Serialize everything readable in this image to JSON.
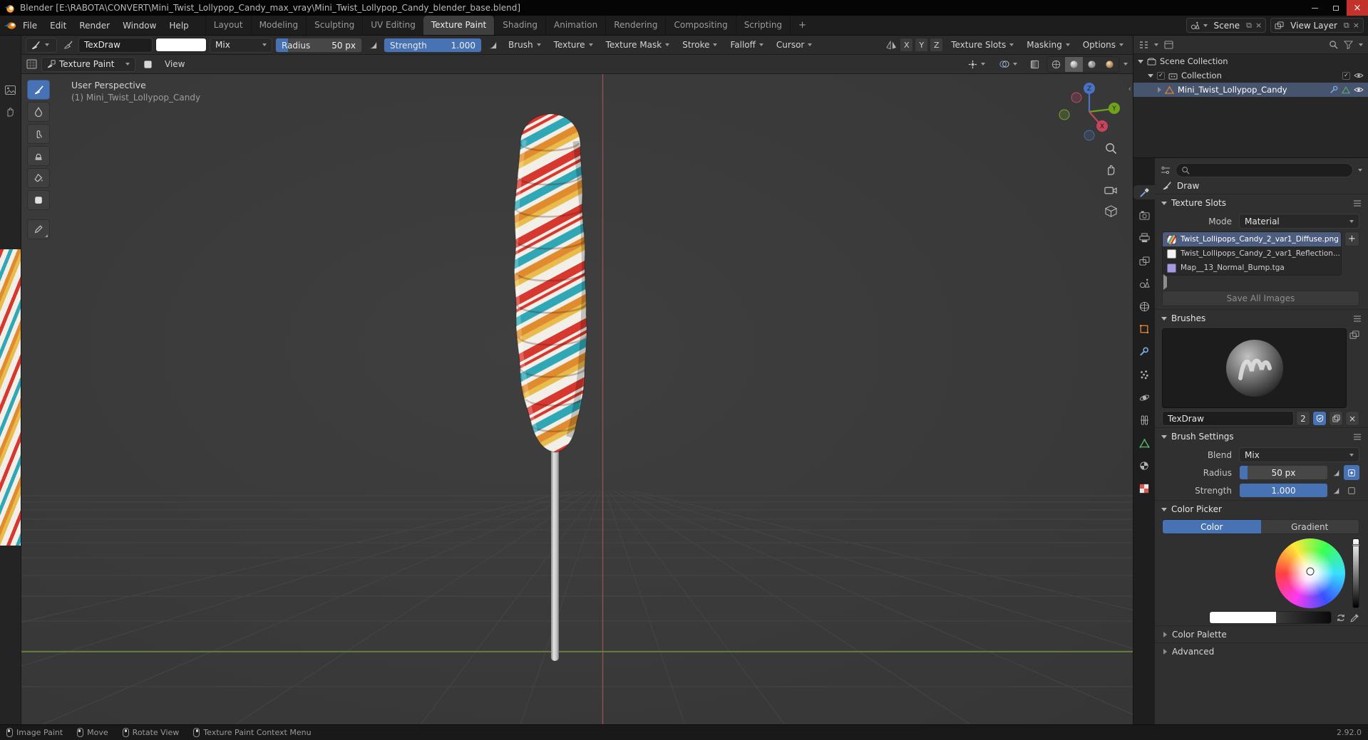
{
  "window": {
    "title": "Blender [E:\\RABOTA\\CONVERT\\Mini_Twist_Lollypop_Candy_max_vray\\Mini_Twist_Lollypop_Candy_blender_base.blend]"
  },
  "topbar": {
    "menus": [
      "File",
      "Edit",
      "Render",
      "Window",
      "Help"
    ],
    "workspaces": [
      "Layout",
      "Modeling",
      "Sculpting",
      "UV Editing",
      "Texture Paint",
      "Shading",
      "Animation",
      "Rendering",
      "Compositing",
      "Scripting"
    ],
    "active_workspace": "Texture Paint",
    "add_tab": "+",
    "scene_label": "Scene",
    "view_layer_label": "View Layer"
  },
  "tool_settings": {
    "brush_name": "TexDraw",
    "blend": "Mix",
    "radius_label": "Radius",
    "radius_value": "50 px",
    "strength_label": "Strength",
    "strength_value": "1.000",
    "popovers": [
      "Brush",
      "Texture",
      "Texture Mask",
      "Stroke",
      "Falloff",
      "Cursor"
    ],
    "mirror": {
      "x": "X",
      "y": "Y",
      "z": "Z"
    },
    "right_popovers": [
      "Texture Slots",
      "Masking",
      "Options"
    ]
  },
  "viewport": {
    "mode": "Texture Paint",
    "view_menu": "View",
    "overlay_line1": "User Perspective",
    "overlay_line2": "(1) Mini_Twist_Lollypop_Candy",
    "gizmo": {
      "x": "X",
      "y": "Y",
      "z": "Z"
    }
  },
  "outliner": {
    "scene_collection": "Scene Collection",
    "collection": "Collection",
    "object": "Mini_Twist_Lollypop_Candy"
  },
  "properties": {
    "tool_label": "Draw",
    "texture_slots": {
      "title": "Texture Slots",
      "mode_label": "Mode",
      "mode_value": "Material",
      "slot1": "Twist_Lollipops_Candy_2_var1_Diffuse.png",
      "slot2": "Twist_Lollipops_Candy_2_var1_Reflection...",
      "slot3": "Map__13_Normal_Bump.tga",
      "save_all": "Save All Images"
    },
    "brushes": {
      "title": "Brushes",
      "name": "TexDraw",
      "users": "2"
    },
    "brush_settings": {
      "title": "Brush Settings",
      "blend_label": "Blend",
      "blend_value": "Mix",
      "radius_label": "Radius",
      "radius_value": "50 px",
      "strength_label": "Strength",
      "strength_value": "1.000"
    },
    "color_picker": {
      "title": "Color Picker",
      "tab_color": "Color",
      "tab_gradient": "Gradient"
    },
    "color_palette_title": "Color Palette",
    "advanced_title": "Advanced"
  },
  "status_bar": {
    "item1": "Image Paint",
    "item2": "Move",
    "item3": "Rotate View",
    "item4": "Texture Paint Context Menu",
    "version": "2.92.0"
  },
  "colors": {
    "accent": "#4772b3",
    "object_orange": "#e8852c",
    "candy_red": "#d6372e",
    "candy_teal": "#2fa7b4",
    "candy_orange": "#e08b2d",
    "candy_yellow": "#e9bb4a"
  }
}
